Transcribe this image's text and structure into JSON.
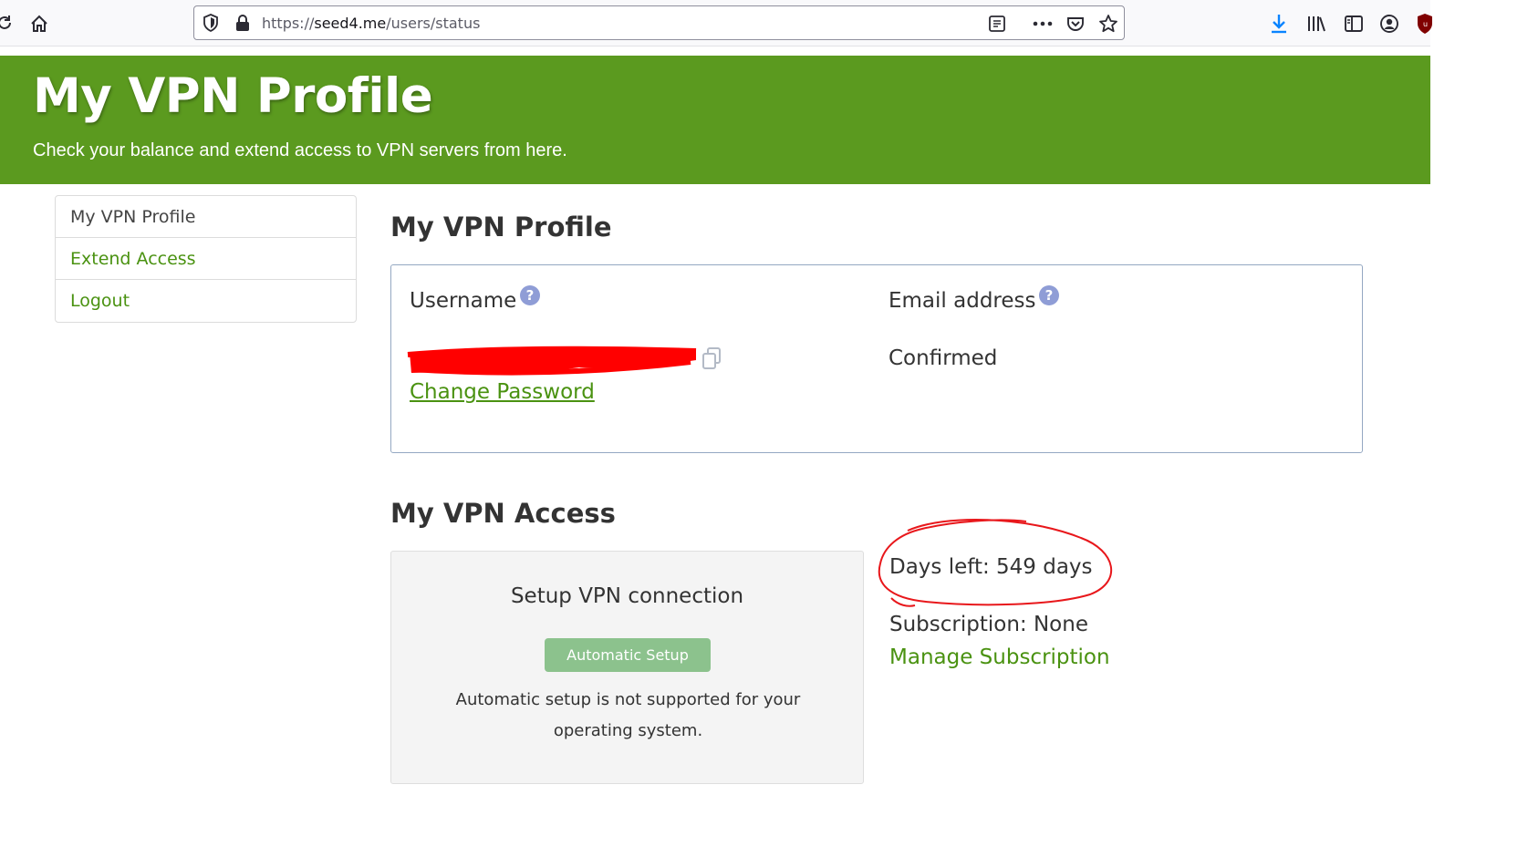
{
  "browser": {
    "url_scheme": "https://",
    "url_host": "seed4.me",
    "url_path": "/users/status",
    "icons": [
      "reload-icon",
      "home-icon",
      "tracking-shield-icon",
      "lock-icon",
      "reader-view-icon",
      "more-actions-icon",
      "pocket-icon",
      "bookmark-star-icon",
      "download-icon",
      "library-icon",
      "sidebar-icon",
      "account-icon",
      "ublock-extension-icon"
    ],
    "colors": {
      "download_icon": "#0a84ff",
      "toolbar_bg": "#f9f9fb"
    }
  },
  "header": {
    "title": "My VPN Profile",
    "subtitle": "Check your balance and extend access to VPN servers from here.",
    "bg_color": "#5b9a1f"
  },
  "sidebar": {
    "items": [
      {
        "label": "My VPN Profile",
        "active": true
      },
      {
        "label": "Extend Access",
        "active": false
      },
      {
        "label": "Logout",
        "active": false
      }
    ]
  },
  "profile": {
    "title": "My VPN Profile",
    "username_label": "Username",
    "help_glyph": "?",
    "username_redacted": true,
    "change_password": "Change Password",
    "email_label": "Email address",
    "email_status": "Confirmed"
  },
  "access": {
    "title": "My VPN Access",
    "setup_title": "Setup VPN connection",
    "setup_button": "Automatic Setup",
    "setup_note": "Automatic setup is not supported for your operating system.",
    "days_left": "Days left: 549 days",
    "subscription": "Subscription: None",
    "manage_subscription": "Manage Subscription"
  },
  "colors": {
    "link_green": "#4a9211",
    "redaction_red": "#ff0000",
    "help_icon": "#8f9dd6"
  }
}
